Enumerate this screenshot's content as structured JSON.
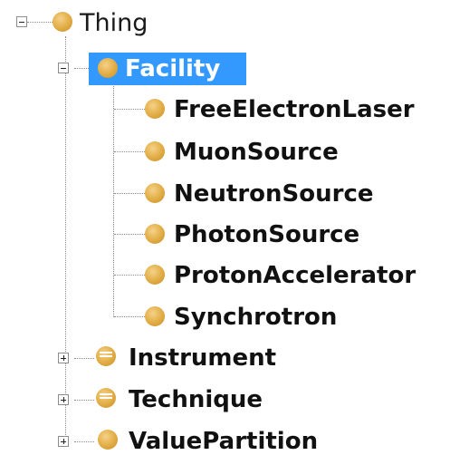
{
  "tree": {
    "root": {
      "label": "Thing",
      "expanded": true,
      "icon": "class-icon"
    },
    "facility": {
      "label": "Facility",
      "selected": true,
      "expanded": true,
      "icon": "class-icon",
      "children": [
        {
          "label": "FreeElectronLaser",
          "icon": "class-icon"
        },
        {
          "label": "MuonSource",
          "icon": "class-icon"
        },
        {
          "label": "NeutronSource",
          "icon": "class-icon"
        },
        {
          "label": "PhotonSource",
          "icon": "class-icon"
        },
        {
          "label": "ProtonAccelerator",
          "icon": "class-icon"
        },
        {
          "label": "Synchrotron",
          "icon": "class-icon"
        }
      ]
    },
    "siblings": [
      {
        "label": "Instrument",
        "expanded": false,
        "icon": "defined-class-icon"
      },
      {
        "label": "Technique",
        "expanded": false,
        "icon": "defined-class-icon"
      },
      {
        "label": "ValuePartition",
        "expanded": false,
        "icon": "class-icon"
      }
    ]
  },
  "colors": {
    "selection": "#3399ff",
    "class_icon": "#e5b24d",
    "connector": "#8a8a8a"
  }
}
